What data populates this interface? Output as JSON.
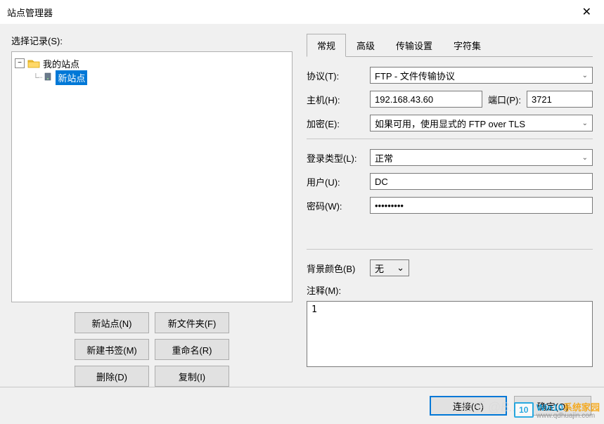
{
  "titlebar": {
    "title": "站点管理器"
  },
  "left": {
    "select_label": "选择记录(S):",
    "tree": {
      "toggle": "−",
      "root": "我的站点",
      "child": "新站点"
    },
    "buttons": {
      "new_site": "新站点(N)",
      "new_folder": "新文件夹(F)",
      "new_bookmark": "新建书签(M)",
      "rename": "重命名(R)",
      "delete": "删除(D)",
      "copy": "复制(I)"
    }
  },
  "tabs": {
    "general": "常规",
    "advanced": "高级",
    "transfer": "传输设置",
    "charset": "字符集"
  },
  "form": {
    "protocol_label": "协议(T):",
    "protocol_value": "FTP - 文件传输协议",
    "host_label": "主机(H):",
    "host_value": "192.168.43.60",
    "port_label": "端口(P):",
    "port_value": "3721",
    "encryption_label": "加密(E):",
    "encryption_value": "如果可用，使用显式的 FTP over TLS",
    "logon_label": "登录类型(L):",
    "logon_value": "正常",
    "user_label": "用户(U):",
    "user_value": "DC",
    "password_label": "密码(W):",
    "password_value": "•••••••••",
    "bgcolor_label": "背景颜色(B)",
    "bgcolor_value": "无",
    "comment_label": "注释(M):",
    "comment_value": "1"
  },
  "footer": {
    "connect": "连接(C)",
    "ok": "确定(O)"
  },
  "watermark": {
    "zhihu": "知乎 @B...",
    "logo": "10",
    "brand_win": "Win10",
    "brand_sys": "系统家园",
    "url": "www.qdhuajin.com"
  }
}
